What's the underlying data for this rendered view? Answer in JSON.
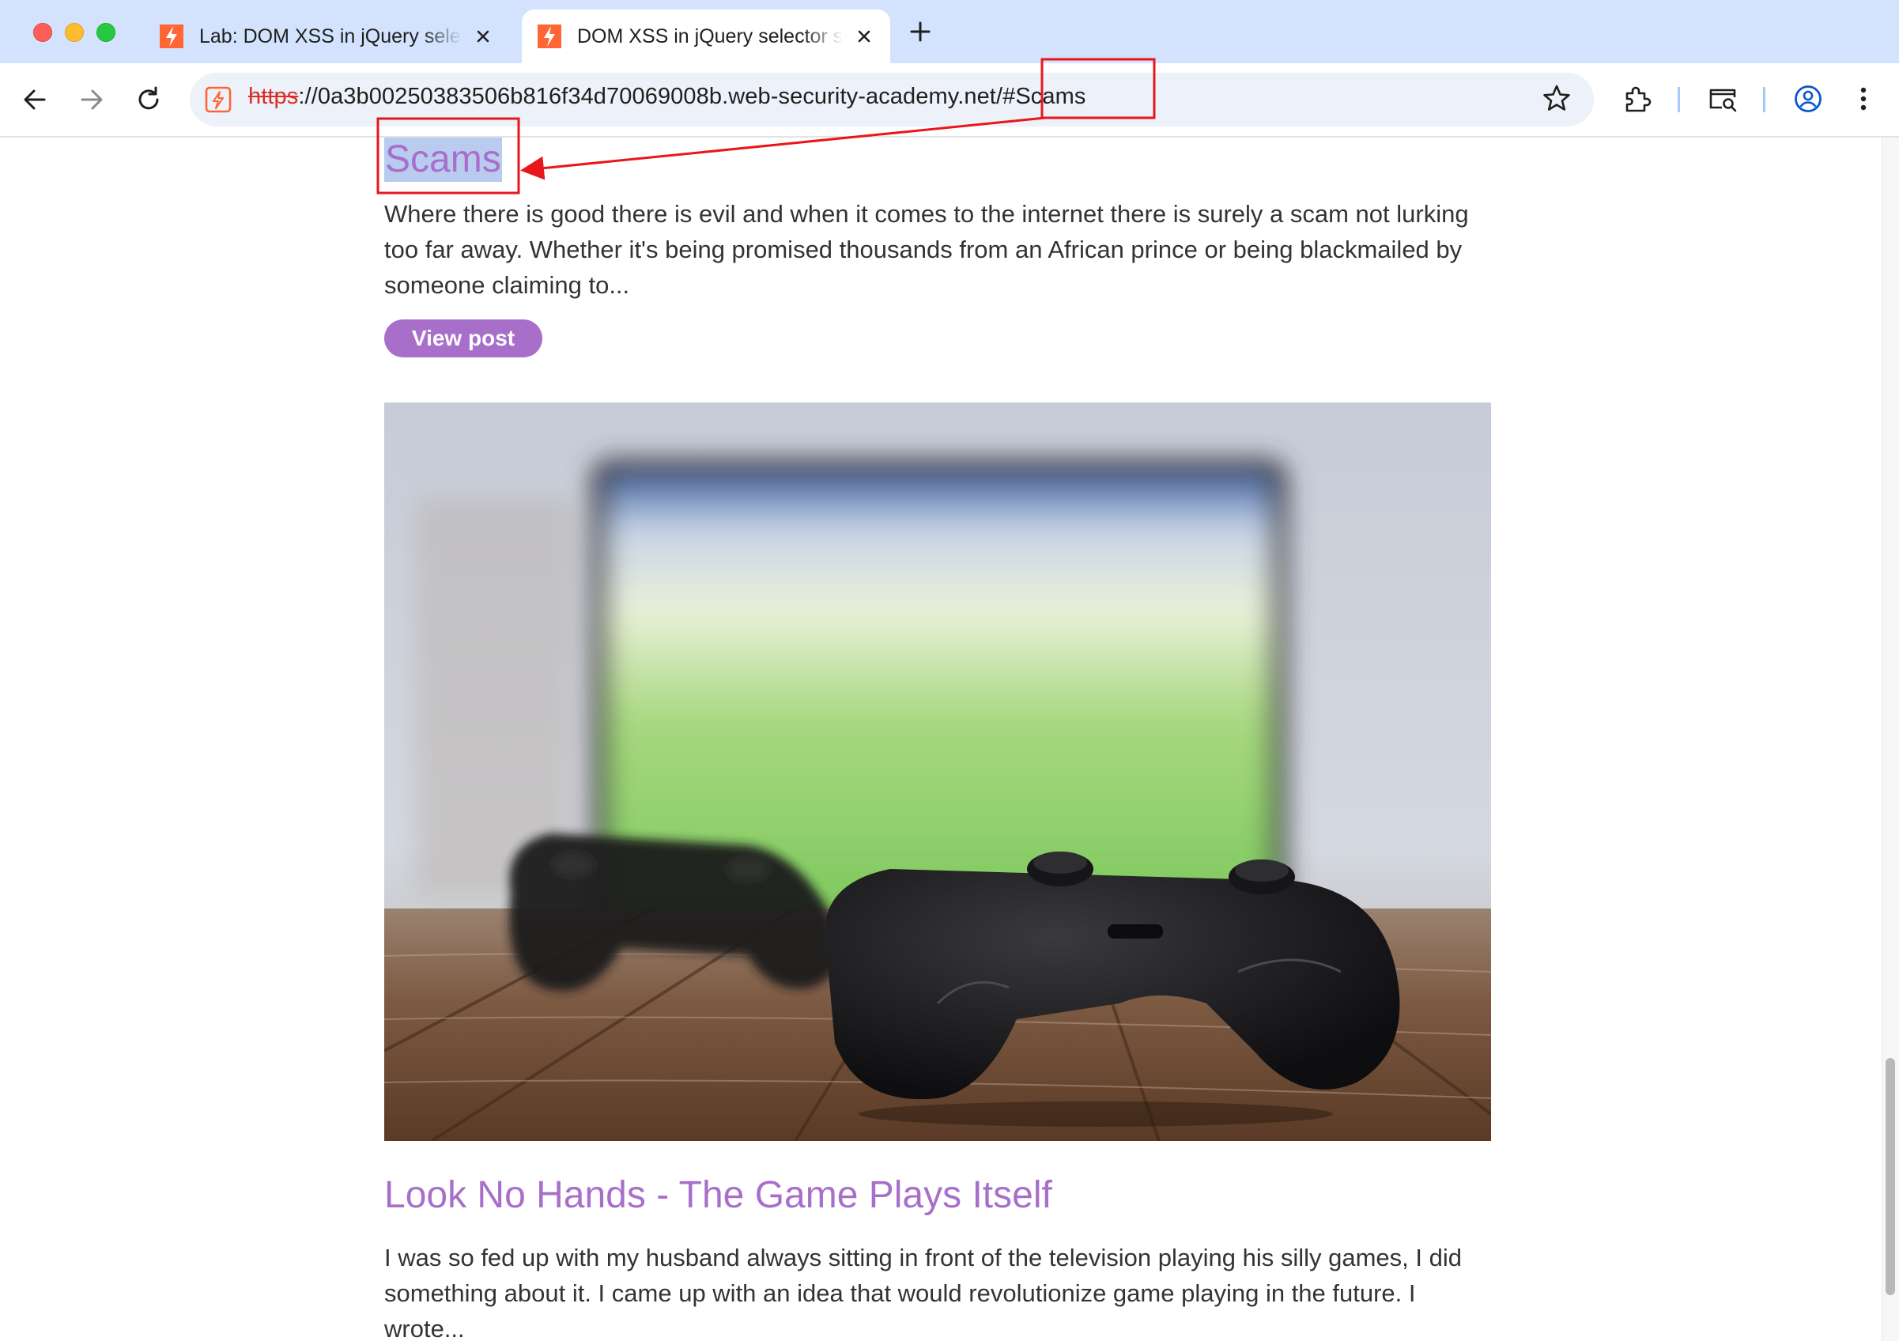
{
  "browser": {
    "tabs": [
      {
        "title": "Lab: DOM XSS in jQuery selector sink using a hashchange event",
        "active": false
      },
      {
        "title": "DOM XSS in jQuery selector sink using a hashchange event",
        "active": true
      }
    ],
    "url": {
      "scheme": "https",
      "rest": "://0a3b00250383506b816f34d70069008b.web-security-academy.net/#Scams"
    },
    "colors": {
      "tabstrip": "#d3e3fd",
      "omnibox": "#edf1fa",
      "favicon": "#ff6633"
    }
  },
  "page": {
    "accent": "#a86fca",
    "posts": [
      {
        "title": "Scams",
        "excerpt": "Where there is good there is evil and when it comes to the internet there is surely a scam not lurking too far away. Whether it's being promised thousands from an African prince or being blackmailed by someone claiming to...",
        "button": "View post",
        "highlighted": true
      },
      {
        "image": "game-controllers-photo",
        "title": "Look No Hands - The Game Plays Itself",
        "excerpt": "I was so fed up with my husband always sitting in front of the television playing his silly games, I did something about it. I came up with an idea that would revolutionize game playing in the future. I wrote..."
      }
    ]
  },
  "annotations": {
    "color": "#e8161b"
  }
}
